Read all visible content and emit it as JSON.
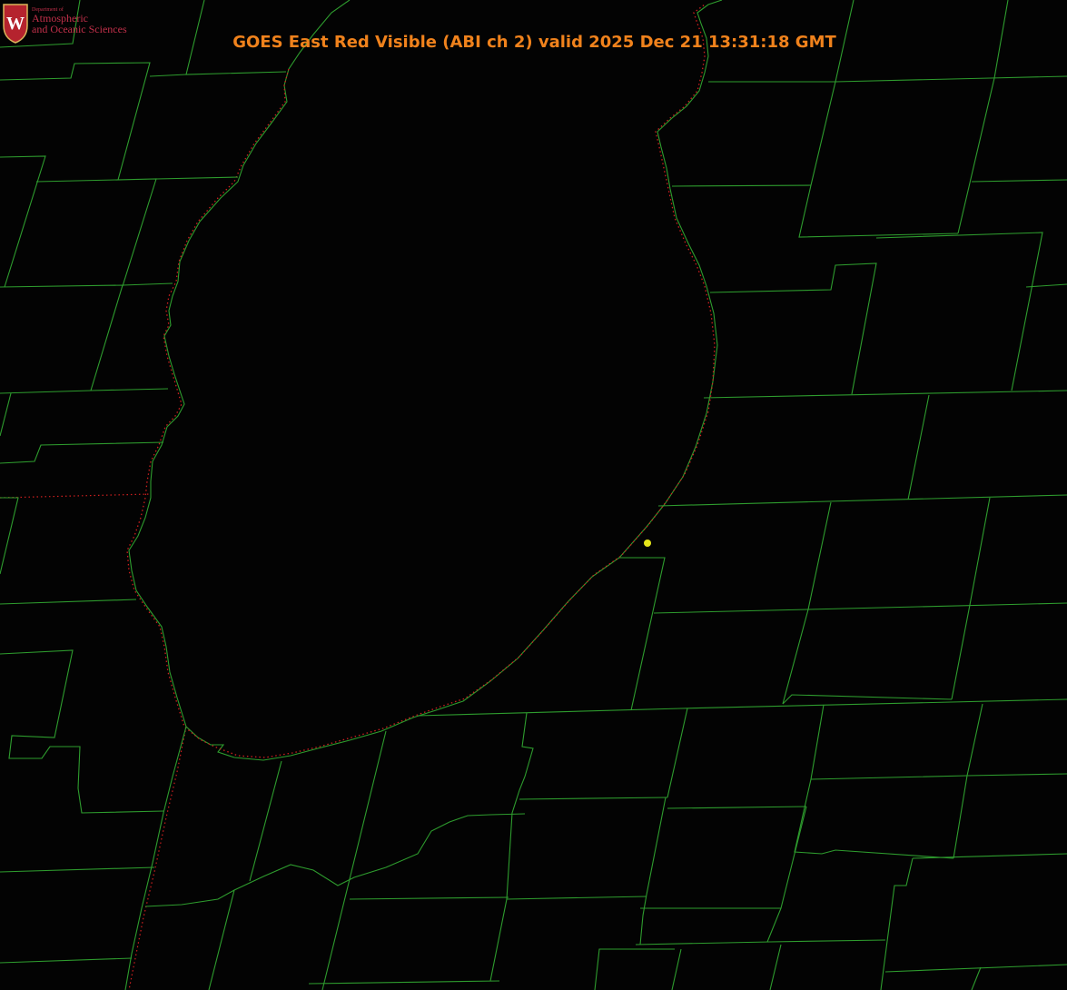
{
  "logo": {
    "department": "Department of",
    "line1": "Atmospheric",
    "line2": "and Oceanic Sciences",
    "crest_letter": "W"
  },
  "title": "GOES East Red Visible (ABI ch 2) valid 2025 Dec 21 13:31:18 GMT",
  "colors": {
    "background": "#030303",
    "county_lines": "#2e9c2e",
    "shoreline_dotted": "#d02020",
    "title": "#f0821c",
    "logo_text": "#c2304a",
    "marker": "#e6e61a"
  },
  "map": {
    "features": [
      "county-boundaries",
      "lake-shoreline",
      "state-border",
      "station-marker"
    ]
  }
}
